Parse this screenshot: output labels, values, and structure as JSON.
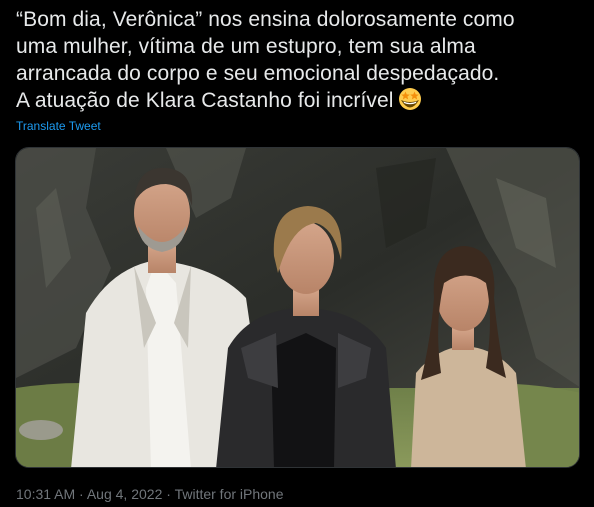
{
  "tweet": {
    "text_lines": [
      "“Bom dia, Verônica” nos ensina dolorosamente como",
      "uma mulher, vítima de um estupro, tem sua alma",
      "arrancada do corpo e seu emocional despedaçado.",
      "A atuação de Klara Castanho foi incrível"
    ],
    "emoji": "star-struck-emoji",
    "translate_label": "Translate Tweet",
    "time": "10:31 AM",
    "separator": "·",
    "date": "Aug 4, 2022",
    "source": "Twitter for iPhone"
  },
  "colors": {
    "background": "#000000",
    "text": "#e7e9ea",
    "link": "#1d9bf0",
    "muted": "#71767b"
  },
  "media": {
    "type": "photo",
    "subject": "three-people-portrait"
  }
}
